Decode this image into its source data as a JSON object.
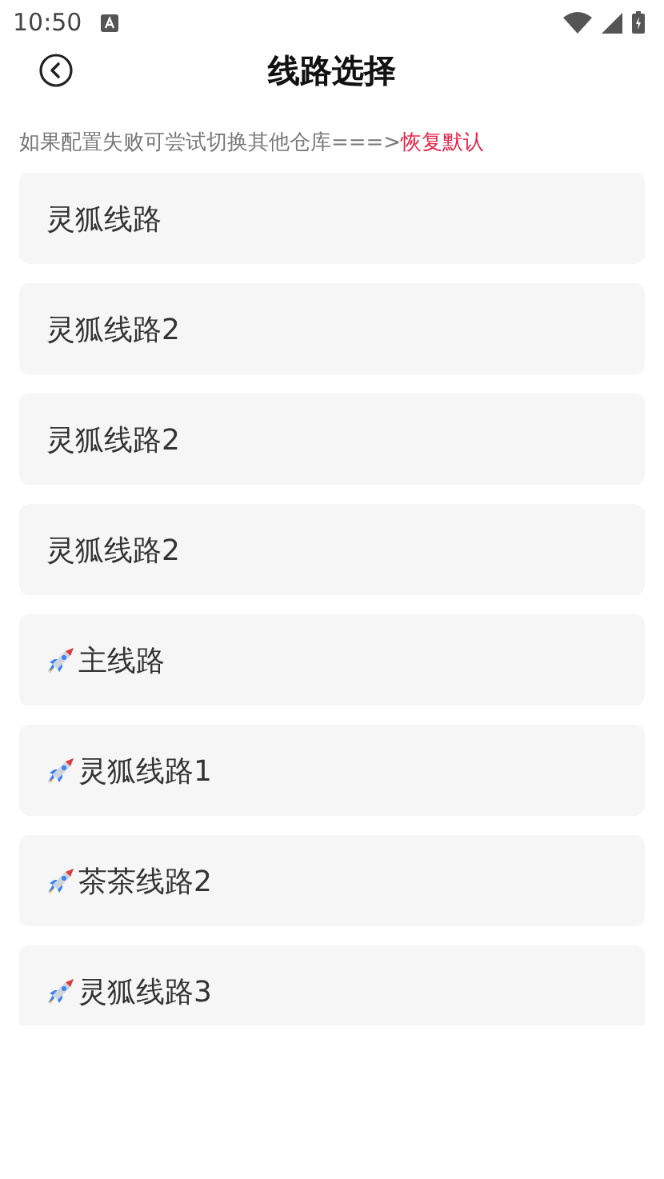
{
  "status_bar": {
    "time": "10:50"
  },
  "header": {
    "title": "线路选择"
  },
  "hint": {
    "text": "如果配置失败可尝试切换其他仓库===>",
    "link": "恢复默认"
  },
  "routes": [
    {
      "label": "灵狐线路",
      "kind": "plain"
    },
    {
      "label": "灵狐线路2",
      "kind": "plain"
    },
    {
      "label": "灵狐线路2",
      "kind": "plain"
    },
    {
      "label": "灵狐线路2",
      "kind": "plain"
    },
    {
      "label": "主线路",
      "kind": "rocket"
    },
    {
      "label": "灵狐线路1",
      "kind": "rocket"
    },
    {
      "label": "茶茶线路2",
      "kind": "rocket"
    },
    {
      "label": "灵狐线路3",
      "kind": "rocket"
    }
  ]
}
